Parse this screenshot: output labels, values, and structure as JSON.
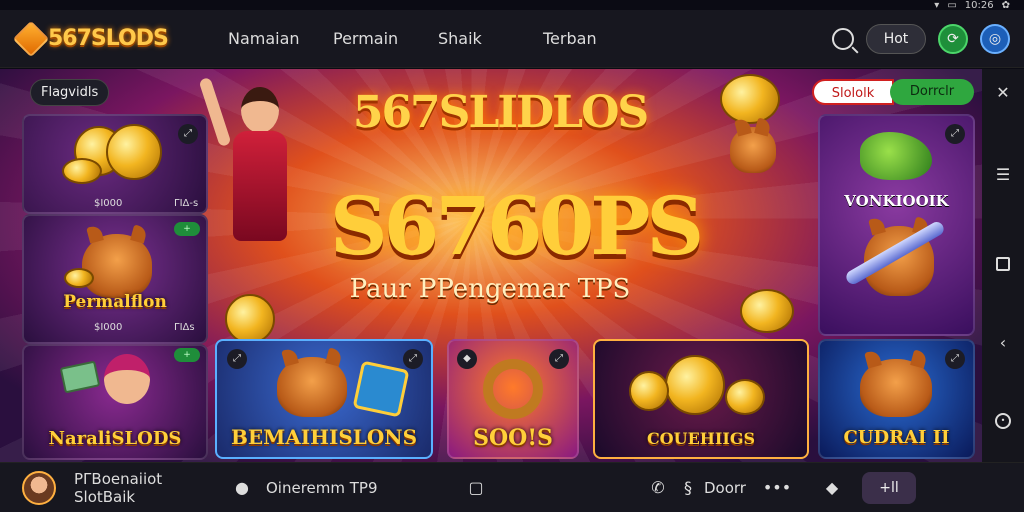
{
  "status": {
    "time": "10:26"
  },
  "header": {
    "logo": "567SLODS",
    "nav": [
      "Namaian",
      "Permain",
      "Shaik",
      "Terban"
    ],
    "hot_label": "Hot"
  },
  "banner": {
    "top_left_pill": "Flagvidls",
    "top_right_red": "Slololk",
    "top_right_green": "Dorrclr",
    "title": "567SLIDLOS",
    "big": "S6760PS",
    "sub": "Paur PPengemar TPS"
  },
  "cards": {
    "left_top_label_a": "$Ι000",
    "left_top_label_b": "ΓΙΔ‑s",
    "left_mid_title": "Permalflon",
    "left_mid_label_a": "$Ι000",
    "left_mid_label_b": "ΓΙΔs",
    "left_bottom_title": "NaraliSLODS",
    "c1_title": "BEMAIHISLONS",
    "c2_title": "SOO!S",
    "c3_title": "COUEHIIGS",
    "right_top_title": "VONKIOOIK",
    "right_bottom_title": "CUDRAI II"
  },
  "footer": {
    "left_text": "PΓΒoenaiiot SlotBaik",
    "mid_text": "Oineremm TP9",
    "right_text": "Doorr",
    "btn_label": "+ll"
  },
  "colors": {
    "accent": "#ffce3a",
    "bg": "#17171f",
    "green": "#2fa73f"
  }
}
